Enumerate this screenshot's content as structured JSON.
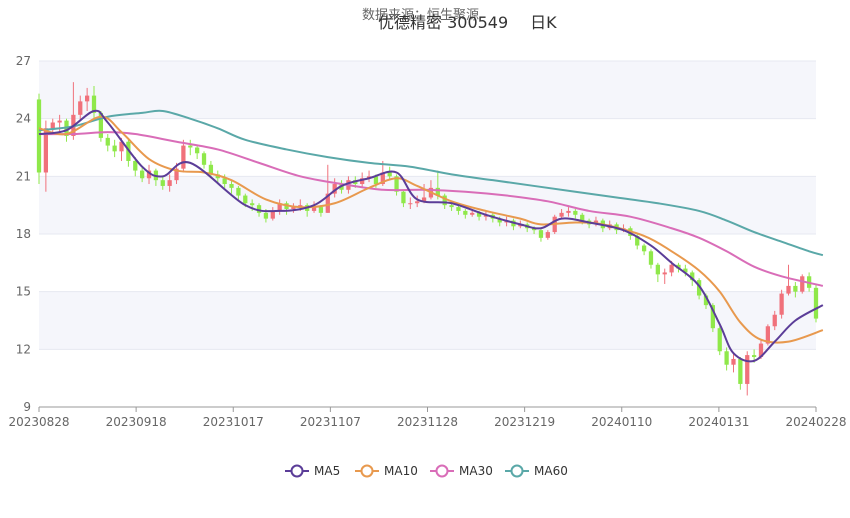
{
  "header": {
    "source": "数据来源：恒生聚源",
    "stock": "优德精密 300549",
    "period": "日K"
  },
  "chart_data": {
    "type": "candlestick",
    "ylim": [
      9,
      27
    ],
    "yticks": [
      9,
      12,
      15,
      18,
      21,
      24,
      27
    ],
    "xticks": [
      "20230828",
      "20230918",
      "20231017",
      "20231107",
      "20231128",
      "20231219",
      "20240110",
      "20240131",
      "20240228"
    ],
    "colors": {
      "up": "#f0717b",
      "down": "#8fe84a",
      "MA5": "#5b3d98",
      "MA10": "#e8994e",
      "MA30": "#d96db8",
      "MA60": "#5aa8a8",
      "band": "#f5f6fb"
    },
    "legend": [
      {
        "name": "MA5",
        "color": "#5b3d98"
      },
      {
        "name": "MA10",
        "color": "#e8994e"
      },
      {
        "name": "MA30",
        "color": "#d96db8"
      },
      {
        "name": "MA60",
        "color": "#5aa8a8"
      }
    ],
    "candles": [
      [
        25.0,
        21.2,
        25.3,
        20.6
      ],
      [
        21.2,
        23.5,
        23.9,
        20.2
      ],
      [
        23.5,
        23.8,
        24.0,
        23.2
      ],
      [
        23.8,
        23.9,
        24.2,
        23.3
      ],
      [
        23.9,
        23.1,
        24.0,
        22.8
      ],
      [
        23.1,
        24.2,
        25.9,
        22.9
      ],
      [
        24.2,
        24.9,
        25.2,
        23.9
      ],
      [
        24.9,
        25.2,
        25.6,
        24.4
      ],
      [
        25.2,
        24.3,
        25.7,
        24.0
      ],
      [
        24.3,
        23.0,
        24.4,
        22.8
      ],
      [
        23.0,
        22.6,
        23.2,
        22.3
      ],
      [
        22.6,
        22.3,
        22.9,
        22.0
      ],
      [
        22.3,
        22.8,
        23.0,
        21.8
      ],
      [
        22.8,
        21.8,
        22.9,
        21.5
      ],
      [
        21.8,
        21.3,
        22.0,
        21.0
      ],
      [
        21.3,
        20.9,
        21.5,
        20.7
      ],
      [
        20.9,
        21.3,
        21.6,
        20.6
      ],
      [
        21.3,
        20.8,
        21.4,
        20.5
      ],
      [
        20.8,
        20.5,
        21.0,
        20.3
      ],
      [
        20.5,
        20.8,
        21.1,
        20.2
      ],
      [
        20.8,
        21.4,
        21.7,
        20.6
      ],
      [
        21.4,
        22.6,
        22.9,
        21.2
      ],
      [
        22.6,
        22.5,
        22.9,
        22.1
      ],
      [
        22.5,
        22.2,
        22.6,
        21.9
      ],
      [
        22.2,
        21.6,
        22.3,
        21.4
      ],
      [
        21.6,
        21.1,
        21.8,
        20.9
      ],
      [
        21.1,
        20.9,
        21.3,
        20.6
      ],
      [
        20.9,
        20.6,
        21.1,
        20.4
      ],
      [
        20.6,
        20.4,
        20.8,
        20.1
      ],
      [
        20.4,
        20.0,
        20.5,
        19.8
      ],
      [
        20.0,
        19.6,
        20.1,
        19.4
      ],
      [
        19.6,
        19.5,
        19.8,
        19.2
      ],
      [
        19.5,
        19.1,
        19.6,
        18.9
      ],
      [
        19.1,
        18.8,
        19.3,
        18.6
      ],
      [
        18.8,
        19.2,
        19.4,
        18.7
      ],
      [
        19.2,
        19.6,
        19.8,
        19.0
      ],
      [
        19.6,
        19.3,
        19.7,
        19.0
      ],
      [
        19.3,
        19.4,
        19.6,
        19.1
      ],
      [
        19.4,
        19.5,
        19.8,
        19.2
      ],
      [
        19.5,
        19.2,
        19.6,
        18.9
      ],
      [
        19.2,
        19.4,
        19.7,
        19.1
      ],
      [
        19.4,
        19.1,
        19.5,
        18.9
      ],
      [
        19.1,
        20.1,
        21.6,
        19.1
      ],
      [
        20.1,
        20.6,
        20.9,
        19.9
      ],
      [
        20.6,
        20.3,
        20.8,
        20.1
      ],
      [
        20.3,
        20.8,
        21.0,
        20.1
      ],
      [
        20.8,
        20.6,
        21.0,
        20.4
      ],
      [
        20.6,
        20.9,
        21.2,
        20.4
      ],
      [
        20.9,
        21.0,
        21.3,
        20.7
      ],
      [
        21.0,
        20.6,
        21.1,
        20.4
      ],
      [
        20.6,
        21.2,
        21.8,
        20.5
      ],
      [
        21.2,
        21.0,
        21.5,
        20.8
      ],
      [
        21.0,
        20.2,
        21.1,
        20.0
      ],
      [
        20.2,
        19.6,
        20.3,
        19.4
      ],
      [
        19.6,
        19.6,
        19.9,
        19.3
      ],
      [
        19.6,
        19.7,
        20.0,
        19.4
      ],
      [
        19.7,
        19.9,
        20.6,
        19.6
      ],
      [
        19.9,
        20.4,
        20.8,
        19.8
      ],
      [
        20.4,
        20.0,
        21.3,
        19.8
      ],
      [
        20.0,
        19.5,
        20.1,
        19.3
      ],
      [
        19.5,
        19.4,
        19.7,
        19.2
      ],
      [
        19.4,
        19.2,
        19.5,
        19.0
      ],
      [
        19.2,
        19.0,
        19.3,
        18.8
      ],
      [
        19.0,
        19.1,
        19.3,
        18.9
      ],
      [
        19.1,
        18.9,
        19.2,
        18.7
      ],
      [
        18.9,
        19.0,
        19.2,
        18.7
      ],
      [
        19.0,
        18.8,
        19.1,
        18.6
      ],
      [
        18.8,
        18.6,
        18.9,
        18.4
      ],
      [
        18.6,
        18.7,
        18.9,
        18.4
      ],
      [
        18.7,
        18.4,
        18.8,
        18.2
      ],
      [
        18.4,
        18.5,
        18.7,
        18.3
      ],
      [
        18.5,
        18.3,
        18.6,
        18.1
      ],
      [
        18.3,
        18.2,
        18.4,
        18.0
      ],
      [
        18.2,
        17.8,
        18.3,
        17.6
      ],
      [
        17.8,
        18.1,
        18.2,
        17.7
      ],
      [
        18.1,
        18.9,
        19.0,
        18.0
      ],
      [
        18.9,
        19.1,
        19.3,
        18.8
      ],
      [
        19.1,
        19.2,
        19.4,
        18.9
      ],
      [
        19.2,
        19.0,
        19.3,
        18.8
      ],
      [
        19.0,
        18.7,
        19.1,
        18.5
      ],
      [
        18.7,
        18.5,
        18.8,
        18.3
      ],
      [
        18.5,
        18.7,
        18.9,
        18.4
      ],
      [
        18.7,
        18.3,
        18.8,
        18.1
      ],
      [
        18.3,
        18.5,
        18.7,
        18.2
      ],
      [
        18.5,
        18.2,
        18.6,
        18.0
      ],
      [
        18.2,
        18.3,
        18.5,
        18.1
      ],
      [
        18.3,
        17.9,
        18.4,
        17.7
      ],
      [
        17.9,
        17.4,
        18.0,
        17.2
      ],
      [
        17.4,
        17.1,
        17.5,
        16.9
      ],
      [
        17.1,
        16.4,
        17.2,
        16.2
      ],
      [
        16.4,
        15.9,
        16.5,
        15.5
      ],
      [
        15.9,
        16.0,
        16.2,
        15.4
      ],
      [
        16.0,
        16.4,
        16.6,
        15.8
      ],
      [
        16.4,
        16.2,
        16.5,
        16.0
      ],
      [
        16.2,
        16.0,
        16.4,
        15.8
      ],
      [
        16.0,
        15.6,
        16.1,
        15.3
      ],
      [
        15.6,
        14.8,
        15.7,
        14.6
      ],
      [
        14.8,
        14.3,
        14.9,
        14.1
      ],
      [
        14.3,
        13.1,
        14.4,
        12.9
      ],
      [
        13.1,
        11.9,
        13.2,
        11.7
      ],
      [
        11.9,
        11.2,
        12.1,
        10.9
      ],
      [
        11.2,
        11.5,
        11.8,
        10.8
      ],
      [
        11.5,
        10.2,
        11.6,
        9.9
      ],
      [
        10.2,
        11.7,
        11.9,
        9.6
      ],
      [
        11.7,
        11.6,
        12.0,
        11.3
      ],
      [
        11.6,
        12.3,
        12.5,
        11.5
      ],
      [
        12.3,
        13.2,
        13.3,
        12.2
      ],
      [
        13.2,
        13.8,
        14.0,
        13.0
      ],
      [
        13.8,
        14.9,
        15.1,
        13.6
      ],
      [
        14.9,
        15.3,
        16.4,
        14.8
      ],
      [
        15.3,
        15.0,
        15.5,
        14.7
      ],
      [
        15.0,
        15.8,
        15.9,
        14.9
      ],
      [
        15.8,
        15.2,
        16.0,
        15.0
      ],
      [
        15.2,
        13.6,
        15.4,
        13.4
      ]
    ],
    "MA5": [
      [
        0,
        23.2
      ],
      [
        4,
        23.4
      ],
      [
        8,
        24.4
      ],
      [
        10,
        23.8
      ],
      [
        15,
        21.5
      ],
      [
        18,
        21.0
      ],
      [
        22,
        21.7
      ],
      [
        30,
        19.5
      ],
      [
        35,
        19.2
      ],
      [
        40,
        19.5
      ],
      [
        44,
        20.5
      ],
      [
        48,
        20.9
      ],
      [
        52,
        21.2
      ],
      [
        55,
        19.8
      ],
      [
        60,
        19.6
      ],
      [
        65,
        19.0
      ],
      [
        70,
        18.5
      ],
      [
        73,
        18.3
      ],
      [
        76,
        18.8
      ],
      [
        80,
        18.6
      ],
      [
        85,
        18.2
      ],
      [
        89,
        17.4
      ],
      [
        92,
        16.5
      ],
      [
        96,
        15.3
      ],
      [
        99,
        13.3
      ],
      [
        101,
        11.8
      ],
      [
        104,
        11.4
      ],
      [
        107,
        12.4
      ],
      [
        110,
        13.5
      ],
      [
        114,
        14.3
      ]
    ],
    "MA10": [
      [
        0,
        23.5
      ],
      [
        4,
        23.2
      ],
      [
        9,
        24.1
      ],
      [
        12,
        23.3
      ],
      [
        16,
        21.9
      ],
      [
        20,
        21.3
      ],
      [
        24,
        21.2
      ],
      [
        28,
        20.8
      ],
      [
        33,
        19.8
      ],
      [
        38,
        19.4
      ],
      [
        43,
        19.6
      ],
      [
        48,
        20.4
      ],
      [
        52,
        20.9
      ],
      [
        55,
        20.5
      ],
      [
        60,
        19.7
      ],
      [
        65,
        19.2
      ],
      [
        70,
        18.8
      ],
      [
        73,
        18.5
      ],
      [
        78,
        18.6
      ],
      [
        82,
        18.5
      ],
      [
        88,
        17.9
      ],
      [
        92,
        17.1
      ],
      [
        96,
        16.1
      ],
      [
        99,
        15.0
      ],
      [
        102,
        13.4
      ],
      [
        105,
        12.5
      ],
      [
        109,
        12.4
      ],
      [
        114,
        13.0
      ]
    ],
    "MA30": [
      [
        0,
        23.2
      ],
      [
        5,
        23.2
      ],
      [
        10,
        23.3
      ],
      [
        14,
        23.2
      ],
      [
        20,
        22.8
      ],
      [
        26,
        22.4
      ],
      [
        32,
        21.7
      ],
      [
        38,
        21.0
      ],
      [
        44,
        20.6
      ],
      [
        50,
        20.3
      ],
      [
        56,
        20.3
      ],
      [
        62,
        20.2
      ],
      [
        68,
        20.0
      ],
      [
        74,
        19.7
      ],
      [
        80,
        19.2
      ],
      [
        86,
        18.9
      ],
      [
        92,
        18.3
      ],
      [
        96,
        17.8
      ],
      [
        100,
        17.1
      ],
      [
        104,
        16.3
      ],
      [
        108,
        15.8
      ],
      [
        114,
        15.3
      ]
    ],
    "MA60": [
      [
        0,
        23.4
      ],
      [
        5,
        23.6
      ],
      [
        10,
        24.1
      ],
      [
        15,
        24.3
      ],
      [
        18,
        24.4
      ],
      [
        22,
        24.0
      ],
      [
        26,
        23.5
      ],
      [
        30,
        22.9
      ],
      [
        36,
        22.4
      ],
      [
        42,
        22.0
      ],
      [
        48,
        21.7
      ],
      [
        54,
        21.5
      ],
      [
        60,
        21.1
      ],
      [
        66,
        20.8
      ],
      [
        72,
        20.5
      ],
      [
        78,
        20.2
      ],
      [
        84,
        19.9
      ],
      [
        90,
        19.6
      ],
      [
        96,
        19.2
      ],
      [
        100,
        18.7
      ],
      [
        104,
        18.1
      ],
      [
        108,
        17.6
      ],
      [
        112,
        17.1
      ],
      [
        114,
        16.9
      ]
    ]
  }
}
